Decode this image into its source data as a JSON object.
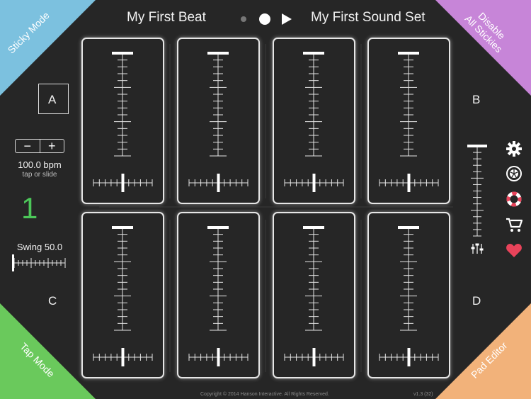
{
  "header": {
    "beat_title": "My First Beat",
    "sound_set_title": "My First Sound Set",
    "record_icon": "record-dot-icon",
    "stop_icon": "stop-circle-icon",
    "play_icon": "play-icon"
  },
  "corners": {
    "top_left": {
      "label": "Sticky Mode",
      "color": "#7cc1df"
    },
    "top_right": {
      "label_line1": "Disable",
      "label_line2": "All Stickies",
      "color": "#c785d8"
    },
    "bottom_left": {
      "label": "Tap Mode",
      "color": "#6ac95c"
    },
    "bottom_right": {
      "label": "Pad Editor",
      "color": "#f2b27a"
    }
  },
  "banks": {
    "a": "A",
    "b": "B",
    "c": "C",
    "d": "D"
  },
  "tempo": {
    "minus": "−",
    "plus": "+",
    "bpm": "100.0 bpm",
    "hint": "tap or slide",
    "beat_count": "1"
  },
  "swing": {
    "label": "Swing 50.0",
    "value": 0.0
  },
  "pads": [
    {
      "volume": 1.0,
      "pan": 0.5
    },
    {
      "volume": 1.0,
      "pan": 0.5
    },
    {
      "volume": 1.0,
      "pan": 0.5
    },
    {
      "volume": 1.0,
      "pan": 0.5
    },
    {
      "volume": 1.0,
      "pan": 0.5
    },
    {
      "volume": 1.0,
      "pan": 0.5
    },
    {
      "volume": 1.0,
      "pan": 0.5
    },
    {
      "volume": 1.0,
      "pan": 0.5
    }
  ],
  "master_volume": {
    "value": 1.0,
    "mixer_icon": "mixer-sliders-icon"
  },
  "toolbar": {
    "settings_icon": "gear-icon",
    "sound_icon": "drum-icon",
    "help_icon": "lifebuoy-icon",
    "store_icon": "cart-icon",
    "favorite_icon": "heart-icon",
    "accent": "#e8435a"
  },
  "footer": {
    "copyright": "Copyright © 2014 Hanson Interactive. All Rights Reserved.",
    "version": "v1.3 (32)"
  }
}
